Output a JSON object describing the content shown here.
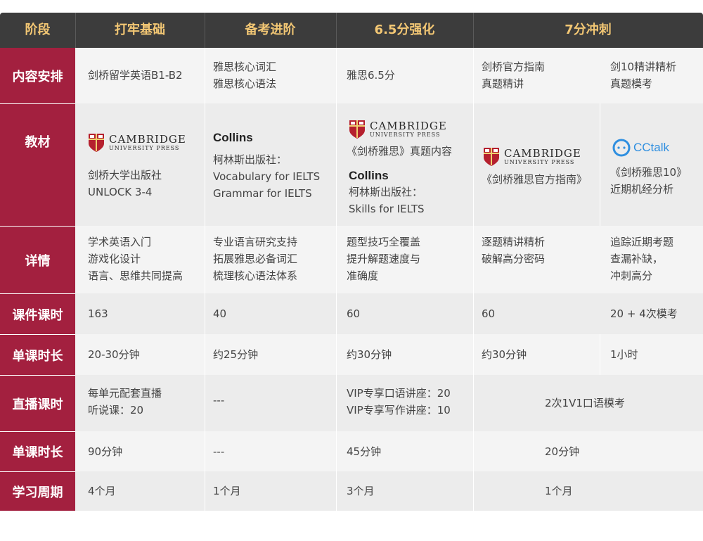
{
  "header": [
    "阶段",
    "打牢基础",
    "备考进阶",
    "6.5分强化",
    "7分冲刺"
  ],
  "rows": {
    "content": {
      "label": "内容安排",
      "c1": [
        "剑桥留学英语B1-B2"
      ],
      "c2": [
        "雅思核心词汇",
        "雅思核心语法"
      ],
      "c3": [
        "雅思6.5分"
      ],
      "c4": [
        "剑桥官方指南",
        "真题精讲"
      ],
      "c5": [
        "剑10精讲精析",
        "真题模考"
      ]
    },
    "textbook": {
      "label": "教材",
      "cambridge_big": "CAMBRIDGE",
      "cambridge_small": "UNIVERSITY PRESS",
      "collins": "Collins",
      "cctalk": "CCtalk",
      "c1": [
        "剑桥大学出版社",
        "UNLOCK 3-4"
      ],
      "c2": [
        "柯林斯出版社：",
        "Vocabulary for IELTS",
        "Grammar for IELTS"
      ],
      "c3a": [
        "《剑桥雅思》真题内容"
      ],
      "c3b": [
        "柯林斯出版社：",
        "Skills for IELTS"
      ],
      "c4": [
        "《剑桥雅思官方指南》"
      ],
      "c5": [
        "《剑桥雅思10》",
        "近期机经分析"
      ]
    },
    "detail": {
      "label": "详情",
      "c1": [
        "学术英语入门",
        "游戏化设计",
        "语言、思维共同提高"
      ],
      "c2": [
        "专业语言研究支持",
        "拓展雅思必备词汇",
        "梳理核心语法体系"
      ],
      "c3": [
        "题型技巧全覆盖",
        "提升解题速度与",
        "准确度"
      ],
      "c4": [
        "逐题精讲精析",
        "破解高分密码"
      ],
      "c5": [
        "追踪近期考题",
        "查漏补缺，",
        "冲刺高分"
      ]
    },
    "hours": {
      "label": "课件课时",
      "c1": "163",
      "c2": "40",
      "c3": "60",
      "c4": "60",
      "c5": "20 + 4次模考"
    },
    "duration": {
      "label": "单课时长",
      "c1": "20-30分钟",
      "c2": "约25分钟",
      "c3": "约30分钟",
      "c4": "约30分钟",
      "c5": "1小时"
    },
    "live": {
      "label": "直播课时",
      "c1": [
        "每单元配套直播",
        "听说课：20"
      ],
      "c2": "---",
      "c3": [
        "VIP专享口语讲座：20",
        "VIP专享写作讲座：10"
      ],
      "c45": "2次1V1口语模考"
    },
    "live_duration": {
      "label": "单课时长",
      "c1": "90分钟",
      "c2": "---",
      "c3": "45分钟",
      "c45": "20分钟"
    },
    "period": {
      "label": "学习周期",
      "c1": "4个月",
      "c2": "1个月",
      "c3": "3个月",
      "c45": "1个月"
    }
  },
  "colors": {
    "header_bg": "#3c3c3c",
    "header_text": "#f3c774",
    "label_bg": "#a3203f",
    "band_a": "#f4f4f4",
    "band_b": "#ececec",
    "cctalk": "#2f8fe0"
  }
}
